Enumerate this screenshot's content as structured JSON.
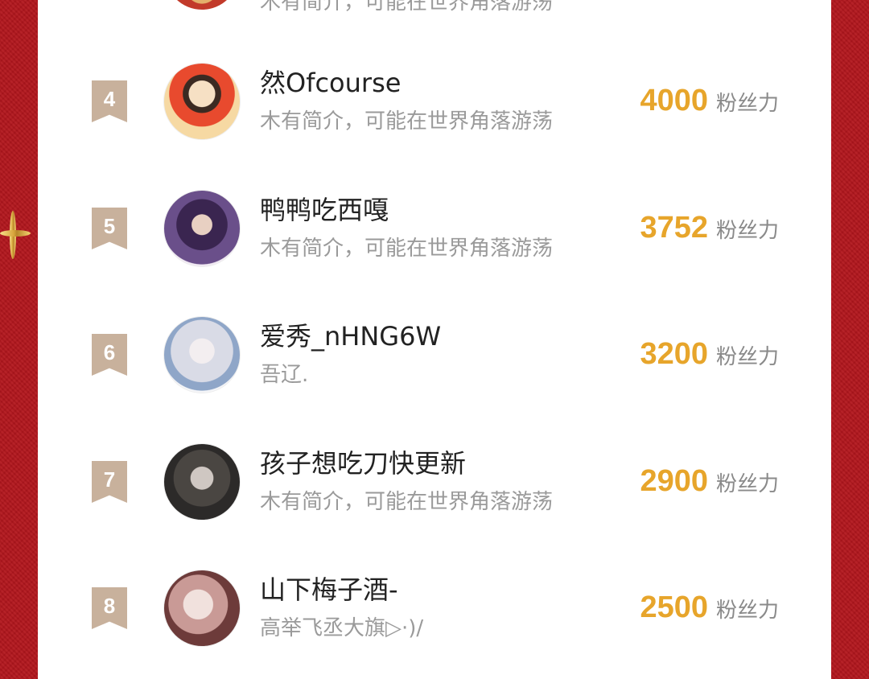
{
  "colors": {
    "background": "#b3161d",
    "panel": "#ffffff",
    "rank_badge": "#c8b19c",
    "score": "#e7a52b",
    "name": "#222222",
    "bio": "#9a9a9a"
  },
  "top_partial": {
    "bio": "木有简介，可能在世界角落游荡"
  },
  "score_unit": "粉丝力",
  "rows": [
    {
      "rank": "4",
      "name": "然Ofcourse",
      "bio": "木有简介，可能在世界角落游荡",
      "score": "4000"
    },
    {
      "rank": "5",
      "name": "鸭鸭吃西嘎",
      "bio": "木有简介，可能在世界角落游荡",
      "score": "3752"
    },
    {
      "rank": "6",
      "name": "爱秀_nHNG6W",
      "bio": "吾辽.",
      "score": "3200"
    },
    {
      "rank": "7",
      "name": "孩子想吃刀快更新",
      "bio": "木有简介，可能在世界角落游荡",
      "score": "2900"
    },
    {
      "rank": "8",
      "name": "山下梅子酒-",
      "bio": "高举飞丞大旗▷·)/",
      "score": "2500"
    }
  ]
}
